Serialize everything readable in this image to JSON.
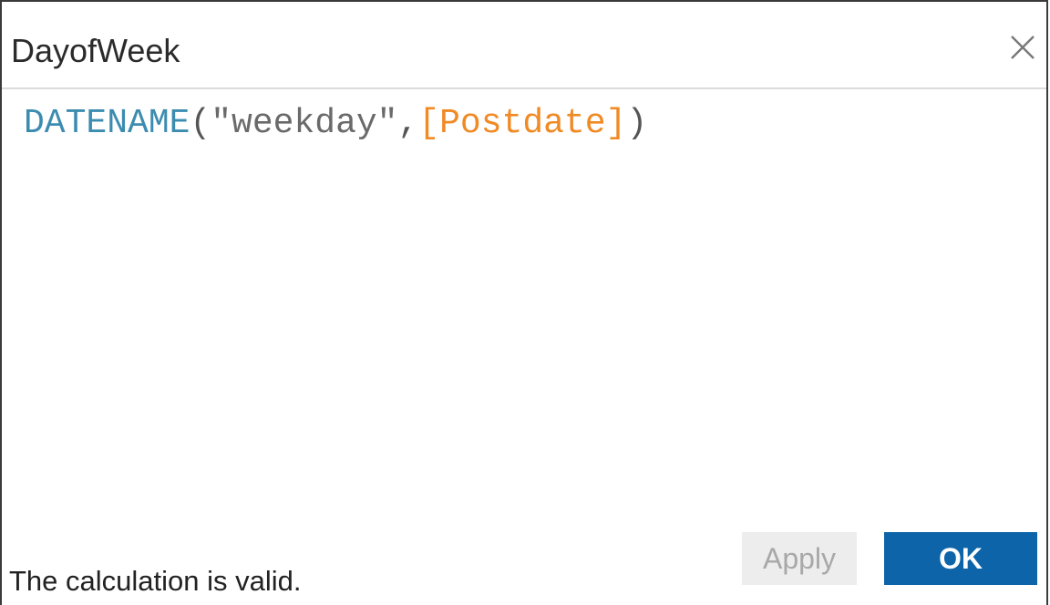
{
  "dialog": {
    "title": "DayofWeek",
    "close_icon": "close-icon"
  },
  "formula": {
    "function": "DATENAME",
    "open_paren": "(",
    "string_arg": "\"weekday\"",
    "comma": ",",
    "field": "[Postdate]",
    "close_paren": ")"
  },
  "status": {
    "message": "The calculation is valid."
  },
  "buttons": {
    "apply_label": "Apply",
    "ok_label": "OK"
  },
  "colors": {
    "function": "#3c8cb0",
    "field": "#f08a24",
    "ok_bg": "#0d64a8",
    "apply_bg": "#ededed"
  }
}
